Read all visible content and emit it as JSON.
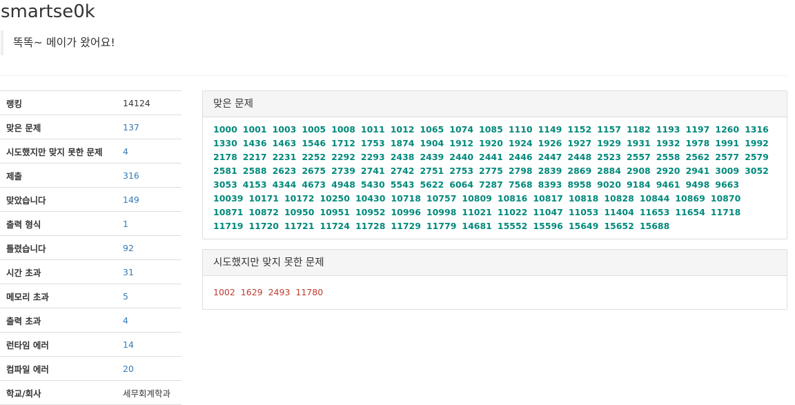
{
  "profile": {
    "username": "smartse0k",
    "status_message": "똑똑~ 메이가 왔어요!"
  },
  "stats": [
    {
      "label": "랭킹",
      "value": "14124",
      "link": false
    },
    {
      "label": "맞은 문제",
      "value": "137",
      "link": true
    },
    {
      "label": "시도했지만 맞지 못한 문제",
      "value": "4",
      "link": true
    },
    {
      "label": "제출",
      "value": "316",
      "link": true
    },
    {
      "label": "맞았습니다",
      "value": "149",
      "link": true
    },
    {
      "label": "출력 형식",
      "value": "1",
      "link": true
    },
    {
      "label": "틀렸습니다",
      "value": "92",
      "link": true
    },
    {
      "label": "시간 초과",
      "value": "31",
      "link": true
    },
    {
      "label": "메모리 초과",
      "value": "5",
      "link": true
    },
    {
      "label": "출력 초과",
      "value": "4",
      "link": true
    },
    {
      "label": "런타임 에러",
      "value": "14",
      "link": true
    },
    {
      "label": "컴파일 에러",
      "value": "20",
      "link": true
    },
    {
      "label": "학교/회사",
      "value": "세무회계학과",
      "link": false
    }
  ],
  "solved_panel": {
    "title": "맞은 문제",
    "problems": [
      "1000",
      "1001",
      "1003",
      "1005",
      "1008",
      "1011",
      "1012",
      "1065",
      "1074",
      "1085",
      "1110",
      "1149",
      "1152",
      "1157",
      "1182",
      "1193",
      "1197",
      "1260",
      "1316",
      "1330",
      "1436",
      "1463",
      "1546",
      "1712",
      "1753",
      "1874",
      "1904",
      "1912",
      "1920",
      "1924",
      "1926",
      "1927",
      "1929",
      "1931",
      "1932",
      "1978",
      "1991",
      "1992",
      "2178",
      "2217",
      "2231",
      "2252",
      "2292",
      "2293",
      "2438",
      "2439",
      "2440",
      "2441",
      "2446",
      "2447",
      "2448",
      "2523",
      "2557",
      "2558",
      "2562",
      "2577",
      "2579",
      "2581",
      "2588",
      "2623",
      "2675",
      "2739",
      "2741",
      "2742",
      "2751",
      "2753",
      "2775",
      "2798",
      "2839",
      "2869",
      "2884",
      "2908",
      "2920",
      "2941",
      "3009",
      "3052",
      "3053",
      "4153",
      "4344",
      "4673",
      "4948",
      "5430",
      "5543",
      "5622",
      "6064",
      "7287",
      "7568",
      "8393",
      "8958",
      "9020",
      "9184",
      "9461",
      "9498",
      "9663",
      "10039",
      "10171",
      "10172",
      "10250",
      "10430",
      "10718",
      "10757",
      "10809",
      "10816",
      "10817",
      "10818",
      "10828",
      "10844",
      "10869",
      "10870",
      "10871",
      "10872",
      "10950",
      "10951",
      "10952",
      "10996",
      "10998",
      "11021",
      "11022",
      "11047",
      "11053",
      "11404",
      "11653",
      "11654",
      "11718",
      "11719",
      "11720",
      "11721",
      "11724",
      "11728",
      "11729",
      "11779",
      "14681",
      "15552",
      "15596",
      "15649",
      "15652",
      "15688"
    ]
  },
  "failed_panel": {
    "title": "시도했지만 맞지 못한 문제",
    "problems": [
      "1002",
      "1629",
      "2493",
      "11780"
    ]
  },
  "colors": {
    "link": "#337ab7",
    "solved": "#00897b",
    "failed": "#c0392b"
  }
}
